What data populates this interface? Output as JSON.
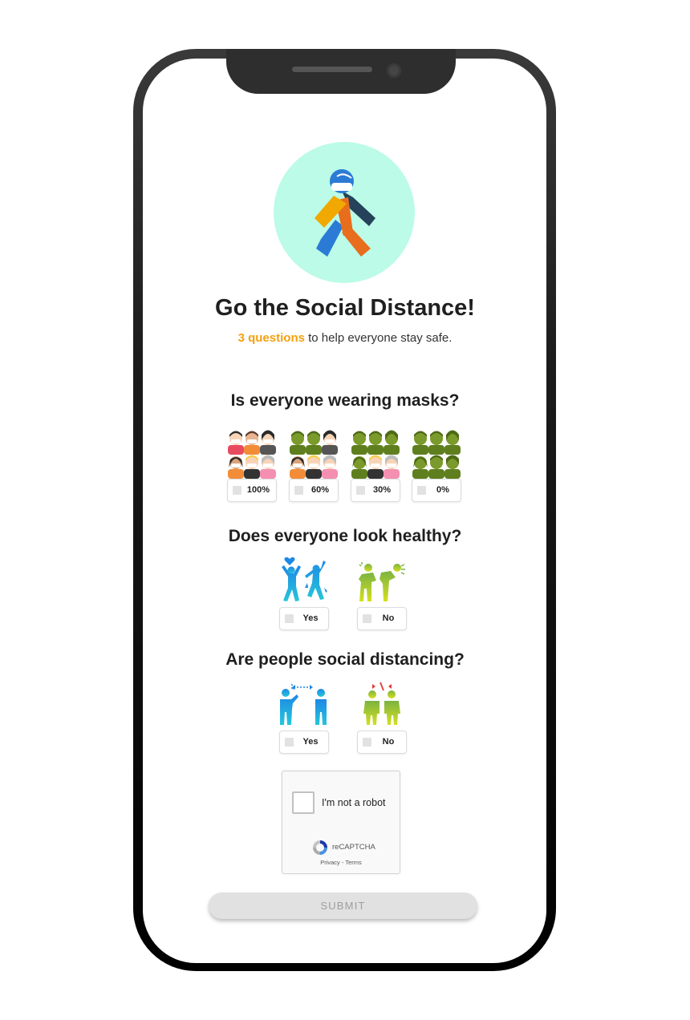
{
  "hero": {
    "icon": "walking-person-with-mask-icon",
    "background": "#bbfbe7"
  },
  "title": "Go the Social Distance!",
  "subtitle": {
    "highlight": "3 questions",
    "rest": " to help everyone stay safe."
  },
  "questions": [
    {
      "text": "Is everyone wearing masks?",
      "options": [
        {
          "label": "100%",
          "icon": "crowd-all-masked-icon"
        },
        {
          "label": "60%",
          "icon": "crowd-mostly-masked-icon"
        },
        {
          "label": "30%",
          "icon": "crowd-few-masked-icon"
        },
        {
          "label": "0%",
          "icon": "crowd-unmasked-icon"
        }
      ]
    },
    {
      "text": "Does everyone look healthy?",
      "options": [
        {
          "label": "Yes",
          "icon": "healthy-people-icon"
        },
        {
          "label": "No",
          "icon": "sick-people-icon"
        }
      ]
    },
    {
      "text": "Are people social distancing?",
      "options": [
        {
          "label": "Yes",
          "icon": "distanced-people-icon"
        },
        {
          "label": "No",
          "icon": "close-people-icon"
        }
      ]
    }
  ],
  "recaptcha": {
    "label": "I'm not a robot",
    "brand": "reCAPTCHA",
    "links": "Privacy - Terms"
  },
  "submit": {
    "label": "SUBMIT"
  },
  "colors": {
    "accent": "#f5a00f",
    "mask_green": "#6e9a22",
    "healthy_blue": "#1e88e5",
    "sick_green": "#9ccc1d"
  }
}
